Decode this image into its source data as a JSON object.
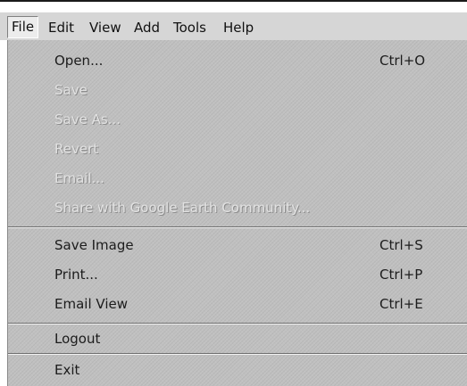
{
  "menubar": {
    "items": [
      {
        "label": "File",
        "active": true
      },
      {
        "label": "Edit"
      },
      {
        "label": "View"
      },
      {
        "label": "Add"
      },
      {
        "label": "Tools"
      },
      {
        "label": "Help"
      }
    ]
  },
  "file_menu": {
    "open": {
      "label": "Open...",
      "shortcut": "Ctrl+O"
    },
    "save": {
      "label": "Save"
    },
    "save_as": {
      "label": "Save As..."
    },
    "revert": {
      "label": "Revert"
    },
    "email": {
      "label": "Email..."
    },
    "share": {
      "label": "Share with Google Earth Community..."
    },
    "save_image": {
      "label": "Save Image",
      "shortcut": "Ctrl+S"
    },
    "print": {
      "label": "Print...",
      "shortcut": "Ctrl+P"
    },
    "email_view": {
      "label": "Email View",
      "shortcut": "Ctrl+E"
    },
    "logout": {
      "label": "Logout"
    },
    "exit": {
      "label": "Exit"
    }
  },
  "colors": {
    "menu_bg": "#c0c0c0",
    "menubar_bg": "#d6d6d6",
    "enabled_text": "#1c1c1c",
    "disabled_text": "#e2e2e2"
  }
}
